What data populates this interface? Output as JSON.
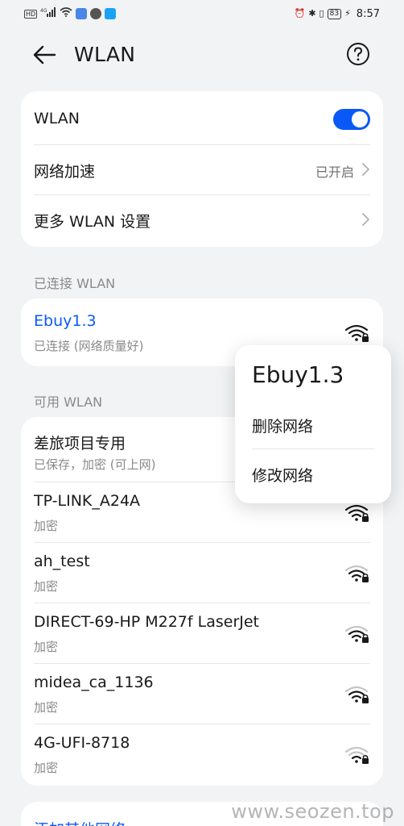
{
  "status_bar": {
    "left_icons": [
      "HD",
      "4G",
      "signal-icon",
      "wifi-icon",
      "app-icon-1",
      "app-icon-2",
      "app-icon-3"
    ],
    "battery": "83",
    "time": "8:57"
  },
  "header": {
    "title": "WLAN"
  },
  "settings_card": {
    "wlan_label": "WLAN",
    "wlan_enabled": true,
    "accel_label": "网络加速",
    "accel_value": "已开启",
    "more_label": "更多 WLAN 设置"
  },
  "connected_section": {
    "label": "已连接 WLAN",
    "network": {
      "name": "Ebuy1.3",
      "status": "已连接 (网络质量好)",
      "color": "#0a59f7"
    }
  },
  "available_section": {
    "label": "可用 WLAN",
    "networks": [
      {
        "name": "差旅项目专用",
        "status": "已保存，加密 (可上网)"
      },
      {
        "name": "TP-LINK_A24A",
        "status": "加密"
      },
      {
        "name": "ah_test",
        "status": "加密"
      },
      {
        "name": "DIRECT-69-HP M227f LaserJet",
        "status": "加密"
      },
      {
        "name": "midea_ca_1136",
        "status": "加密"
      },
      {
        "name": "4G-UFI-8718",
        "status": "加密"
      }
    ]
  },
  "add_network": {
    "label": "添加其他网络"
  },
  "popup": {
    "title": "Ebuy1.3",
    "delete_label": "删除网络",
    "modify_label": "修改网络"
  },
  "watermark": "www.seozen.top",
  "colors": {
    "accent": "#0a59f7",
    "background": "#f1f3f5"
  }
}
